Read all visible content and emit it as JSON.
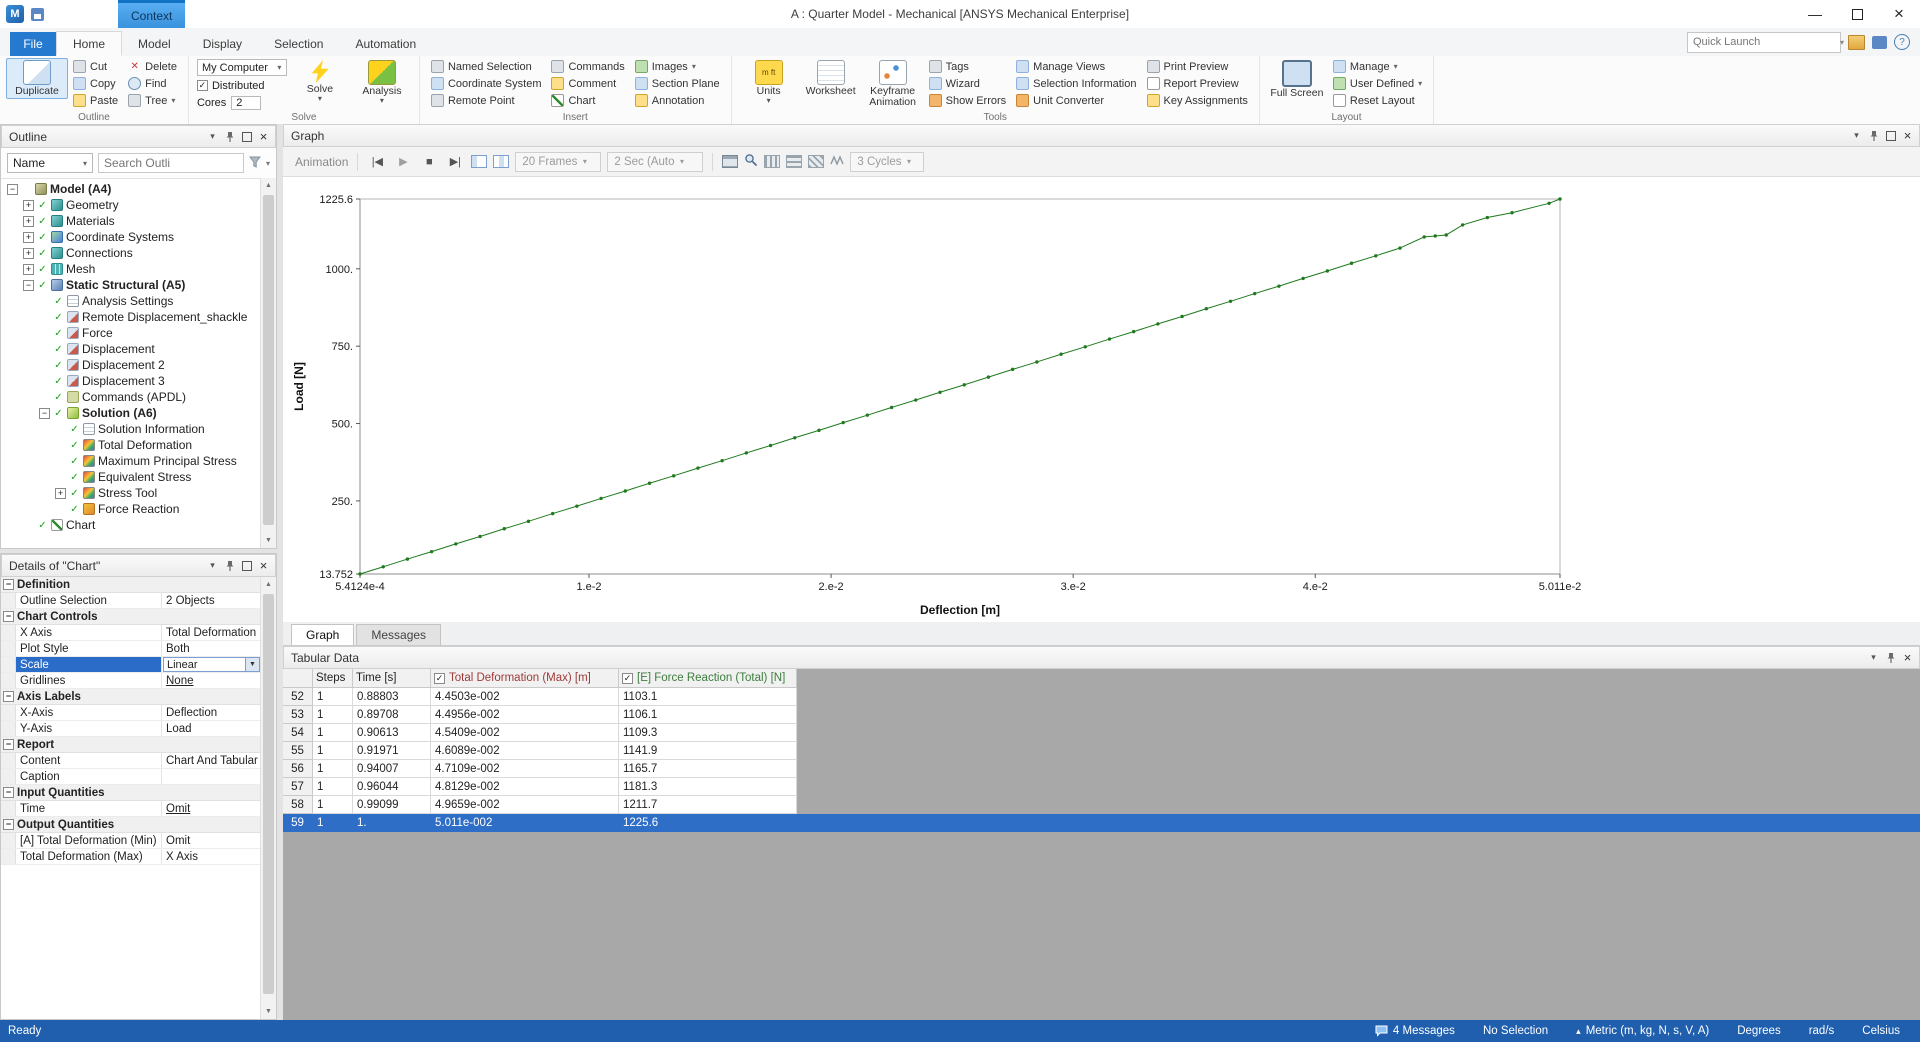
{
  "window": {
    "app_icon": "M",
    "title": "A : Quarter Model - Mechanical [ANSYS Mechanical Enterprise]",
    "context_tab": "Context"
  },
  "ribbon_tabs": {
    "file": "File",
    "tabs": [
      "Home",
      "Model",
      "Display",
      "Selection",
      "Automation"
    ],
    "active": "Home",
    "quick_launch_placeholder": "Quick Launch"
  },
  "ribbon": {
    "groups": [
      {
        "label": "Outline",
        "items": [
          {
            "kind": "big",
            "label": "Duplicate",
            "icon": "duplicate",
            "selected": true
          },
          {
            "kind": "col",
            "items": [
              {
                "label": "Cut",
                "icon": "cut"
              },
              {
                "label": "Copy",
                "icon": "copy"
              },
              {
                "label": "Paste",
                "icon": "paste"
              }
            ]
          },
          {
            "kind": "col",
            "items": [
              {
                "label": "Delete",
                "icon": "delete"
              },
              {
                "label": "Find",
                "icon": "find"
              },
              {
                "label": "Tree",
                "icon": "tree",
                "dropdown": true
              }
            ]
          }
        ]
      },
      {
        "label": "Solve",
        "items": [
          {
            "kind": "col",
            "items": [
              {
                "control": "combo",
                "label": "My Computer"
              },
              {
                "control": "checkbox",
                "label": "Distributed",
                "checked": true
              },
              {
                "control": "cores",
                "label": "Cores",
                "value": "2"
              }
            ]
          },
          {
            "kind": "big",
            "label": "Solve",
            "icon": "solve",
            "dropdown": true
          },
          {
            "kind": "big",
            "label": "Analysis",
            "icon": "analysis",
            "dropdown": true
          }
        ]
      },
      {
        "label": "Insert",
        "items": [
          {
            "kind": "col",
            "items": [
              {
                "label": "Named Selection",
                "icon": "named-selection"
              },
              {
                "label": "Coordinate System",
                "icon": "coordinate-system"
              },
              {
                "label": "Remote Point",
                "icon": "remote-point"
              }
            ]
          },
          {
            "kind": "col",
            "items": [
              {
                "label": "Commands",
                "icon": "commands"
              },
              {
                "label": "Comment",
                "icon": "comment"
              },
              {
                "label": "Chart",
                "icon": "chart"
              }
            ]
          },
          {
            "kind": "col",
            "items": [
              {
                "label": "Images",
                "icon": "images",
                "dropdown": true
              },
              {
                "label": "Section Plane",
                "icon": "section-plane"
              },
              {
                "label": "Annotation",
                "icon": "annotation"
              }
            ]
          }
        ]
      },
      {
        "label": "Tools",
        "items": [
          {
            "kind": "big",
            "label": "Units",
            "icon": "units",
            "dropdown": true
          },
          {
            "kind": "big",
            "label": "Worksheet",
            "icon": "worksheet"
          },
          {
            "kind": "big",
            "label": "Keyframe Animation",
            "icon": "keyframe-animation"
          },
          {
            "kind": "col",
            "items": [
              {
                "label": "Tags",
                "icon": "tags"
              },
              {
                "label": "Wizard",
                "icon": "wizard"
              },
              {
                "label": "Show Errors",
                "icon": "show-errors"
              }
            ]
          },
          {
            "kind": "col",
            "items": [
              {
                "label": "Manage Views",
                "icon": "manage-views"
              },
              {
                "label": "Selection Information",
                "icon": "selection-information"
              },
              {
                "label": "Unit Converter",
                "icon": "unit-converter"
              }
            ]
          },
          {
            "kind": "col",
            "items": [
              {
                "label": "Print Preview",
                "icon": "print-preview"
              },
              {
                "label": "Report Preview",
                "icon": "report-preview"
              },
              {
                "label": "Key Assignments",
                "icon": "key-assignments"
              }
            ]
          }
        ]
      },
      {
        "label": "Layout",
        "items": [
          {
            "kind": "big",
            "label": "Full Screen",
            "icon": "full-screen"
          },
          {
            "kind": "col",
            "items": [
              {
                "label": "Manage",
                "icon": "manage",
                "dropdown": true
              },
              {
                "label": "User Defined",
                "icon": "user-defined",
                "dropdown": true
              },
              {
                "label": "Reset Layout",
                "icon": "reset-layout"
              }
            ]
          }
        ]
      }
    ]
  },
  "outline": {
    "title": "Outline",
    "name_filter": "Name",
    "search_placeholder": "Search Outli",
    "tree": [
      {
        "label": "Model (A4)",
        "depth": 0,
        "expand": "minus",
        "check": false,
        "bold": true,
        "icon": "model"
      },
      {
        "label": "Geometry",
        "depth": 1,
        "expand": "plus",
        "check": true,
        "icon": "cube"
      },
      {
        "label": "Materials",
        "depth": 1,
        "expand": "plus",
        "check": true,
        "icon": "cube"
      },
      {
        "label": "Coordinate Systems",
        "depth": 1,
        "expand": "plus",
        "check": true,
        "icon": "axes"
      },
      {
        "label": "Connections",
        "depth": 1,
        "expand": "plus",
        "check": true,
        "icon": "cube"
      },
      {
        "label": "Mesh",
        "depth": 1,
        "expand": "plus",
        "check": true,
        "icon": "mesh"
      },
      {
        "label": "Static Structural (A5)",
        "depth": 1,
        "expand": "minus",
        "check": true,
        "bold": true,
        "icon": "static"
      },
      {
        "label": "Analysis Settings",
        "depth": 2,
        "expand": "none",
        "check": true,
        "icon": "doc"
      },
      {
        "label": "Remote Displacement_shackle",
        "depth": 2,
        "expand": "none",
        "check": true,
        "icon": "load"
      },
      {
        "label": "Force",
        "depth": 2,
        "expand": "none",
        "check": true,
        "icon": "load"
      },
      {
        "label": "Displacement",
        "depth": 2,
        "expand": "none",
        "check": true,
        "icon": "load"
      },
      {
        "label": "Displacement 2",
        "depth": 2,
        "expand": "none",
        "check": true,
        "icon": "load"
      },
      {
        "label": "Displacement 3",
        "depth": 2,
        "expand": "none",
        "check": true,
        "icon": "load"
      },
      {
        "label": "Commands (APDL)",
        "depth": 2,
        "expand": "none",
        "check": true,
        "icon": "cmd"
      },
      {
        "label": "Solution (A6)",
        "depth": 2,
        "expand": "minus",
        "check": true,
        "bold": true,
        "icon": "solution"
      },
      {
        "label": "Solution Information",
        "depth": 3,
        "expand": "none",
        "check": true,
        "icon": "doc"
      },
      {
        "label": "Total Deformation",
        "depth": 3,
        "expand": "none",
        "check": true,
        "icon": "result"
      },
      {
        "label": "Maximum Principal Stress",
        "depth": 3,
        "expand": "none",
        "check": true,
        "icon": "result"
      },
      {
        "label": "Equivalent Stress",
        "depth": 3,
        "expand": "none",
        "check": true,
        "icon": "result"
      },
      {
        "label": "Stress Tool",
        "depth": 3,
        "expand": "plus",
        "check": true,
        "icon": "result"
      },
      {
        "label": "Force Reaction",
        "depth": 3,
        "expand": "none",
        "check": true,
        "icon": "probe"
      },
      {
        "label": "Chart",
        "depth": 1,
        "expand": "none",
        "check": true,
        "icon": "chart"
      }
    ]
  },
  "details": {
    "title": "Details of \"Chart\"",
    "rows": [
      {
        "type": "category",
        "label": "Definition"
      },
      {
        "type": "row",
        "key": "Outline Selection",
        "value": "2 Objects"
      },
      {
        "type": "category",
        "label": "Chart Controls"
      },
      {
        "type": "row",
        "key": "X Axis",
        "value": "Total Deformation ..."
      },
      {
        "type": "row",
        "key": "Plot Style",
        "value": "Both"
      },
      {
        "type": "row",
        "key": "Scale",
        "value": "Linear",
        "selected": true,
        "control": "dropdown"
      },
      {
        "type": "row",
        "key": "Gridlines",
        "value": "None",
        "underline": true
      },
      {
        "type": "category",
        "label": "Axis Labels"
      },
      {
        "type": "row",
        "key": "X-Axis",
        "value": "Deflection"
      },
      {
        "type": "row",
        "key": "Y-Axis",
        "value": "Load"
      },
      {
        "type": "category",
        "label": "Report"
      },
      {
        "type": "row",
        "key": "Content",
        "value": "Chart And Tabular ..."
      },
      {
        "type": "row",
        "key": "Caption",
        "value": ""
      },
      {
        "type": "category",
        "label": "Input Quantities"
      },
      {
        "type": "row",
        "key": "Time",
        "value": "Omit",
        "underline": true
      },
      {
        "type": "category",
        "label": "Output Quantities"
      },
      {
        "type": "row",
        "key": "[A] Total Deformation (Min)",
        "value": "Omit"
      },
      {
        "type": "row",
        "key": "Total Deformation (Max)",
        "value": "X Axis"
      }
    ]
  },
  "graph": {
    "title": "Graph",
    "toolbar": {
      "animation": "Animation",
      "frames": "20 Frames",
      "duration": "2 Sec (Auto",
      "cycles": "3 Cycles"
    },
    "tabs": [
      "Graph",
      "Messages"
    ],
    "active_tab": "Graph"
  },
  "chart_data": {
    "type": "line",
    "title": "",
    "xlabel": "Deflection [m]",
    "ylabel": "Load [N]",
    "xlim": [
      0.00054124,
      0.05011
    ],
    "ylim": [
      13.752,
      1225.6
    ],
    "grid": "none",
    "line_color": "#1f7a1f",
    "x_ticks": [
      {
        "v": 0.00054124,
        "label": "5.4124e-4"
      },
      {
        "v": 0.01,
        "label": "1.e-2"
      },
      {
        "v": 0.02,
        "label": "2.e-2"
      },
      {
        "v": 0.03,
        "label": "3.e-2"
      },
      {
        "v": 0.04,
        "label": "4.e-2"
      },
      {
        "v": 0.05011,
        "label": "5.011e-2"
      }
    ],
    "y_ticks": [
      {
        "v": 1225.6,
        "label": "1225.6"
      },
      {
        "v": 1000,
        "label": "1000."
      },
      {
        "v": 750,
        "label": "750."
      },
      {
        "v": 500,
        "label": "500."
      },
      {
        "v": 250,
        "label": "250."
      },
      {
        "v": 13.752,
        "label": "13.752"
      }
    ],
    "series": [
      {
        "points": [
          [
            0.00054124,
            13.752
          ],
          [
            0.0015,
            37
          ],
          [
            0.0025,
            62
          ],
          [
            0.0035,
            86
          ],
          [
            0.0045,
            111
          ],
          [
            0.0055,
            135
          ],
          [
            0.0065,
            160
          ],
          [
            0.0075,
            184
          ],
          [
            0.0085,
            209
          ],
          [
            0.0095,
            233
          ],
          [
            0.0105,
            258
          ],
          [
            0.0115,
            282
          ],
          [
            0.0125,
            307
          ],
          [
            0.0135,
            331
          ],
          [
            0.0145,
            356
          ],
          [
            0.0155,
            380
          ],
          [
            0.0165,
            405
          ],
          [
            0.0175,
            429
          ],
          [
            0.0185,
            454
          ],
          [
            0.0195,
            478
          ],
          [
            0.0205,
            503
          ],
          [
            0.0215,
            527
          ],
          [
            0.0225,
            552
          ],
          [
            0.0235,
            576
          ],
          [
            0.0245,
            601
          ],
          [
            0.0255,
            625
          ],
          [
            0.0265,
            650
          ],
          [
            0.0275,
            675
          ],
          [
            0.0285,
            699
          ],
          [
            0.0295,
            724
          ],
          [
            0.0305,
            748
          ],
          [
            0.0315,
            773
          ],
          [
            0.0325,
            797
          ],
          [
            0.0335,
            822
          ],
          [
            0.0345,
            846
          ],
          [
            0.0355,
            871
          ],
          [
            0.0365,
            895
          ],
          [
            0.0375,
            920
          ],
          [
            0.0385,
            944
          ],
          [
            0.0395,
            969
          ],
          [
            0.0405,
            993
          ],
          [
            0.0415,
            1018
          ],
          [
            0.0425,
            1042
          ],
          [
            0.0435,
            1067
          ],
          [
            0.044503,
            1103.1
          ],
          [
            0.044956,
            1106.1
          ],
          [
            0.045409,
            1109.3
          ],
          [
            0.046089,
            1141.9
          ],
          [
            0.047109,
            1165.7
          ],
          [
            0.048129,
            1181.3
          ],
          [
            0.049659,
            1211.7
          ],
          [
            0.05011,
            1225.6
          ]
        ]
      }
    ]
  },
  "tabular": {
    "title": "Tabular Data",
    "headers": {
      "steps": "Steps",
      "time": "Time [s]",
      "deformation": "Total Deformation (Max) [m]",
      "force": "[E] Force Reaction  (Total) [N]"
    },
    "rows": [
      {
        "n": "52",
        "steps": "1",
        "time": "0.88803",
        "deformation": "4.4503e-002",
        "force": "1103.1"
      },
      {
        "n": "53",
        "steps": "1",
        "time": "0.89708",
        "deformation": "4.4956e-002",
        "force": "1106.1"
      },
      {
        "n": "54",
        "steps": "1",
        "time": "0.90613",
        "deformation": "4.5409e-002",
        "force": "1109.3"
      },
      {
        "n": "55",
        "steps": "1",
        "time": "0.91971",
        "deformation": "4.6089e-002",
        "force": "1141.9"
      },
      {
        "n": "56",
        "steps": "1",
        "time": "0.94007",
        "deformation": "4.7109e-002",
        "force": "1165.7"
      },
      {
        "n": "57",
        "steps": "1",
        "time": "0.96044",
        "deformation": "4.8129e-002",
        "force": "1181.3"
      },
      {
        "n": "58",
        "steps": "1",
        "time": "0.99099",
        "deformation": "4.9659e-002",
        "force": "1211.7"
      },
      {
        "n": "59",
        "steps": "1",
        "time": "1.",
        "deformation": "5.011e-002",
        "force": "1225.6",
        "selected": true
      }
    ]
  },
  "status": {
    "ready": "Ready",
    "messages": "4 Messages",
    "selection": "No Selection",
    "units": "Metric (m, kg, N, s, V, A)",
    "degrees": "Degrees",
    "rad": "rad/s",
    "celsius": "Celsius"
  }
}
